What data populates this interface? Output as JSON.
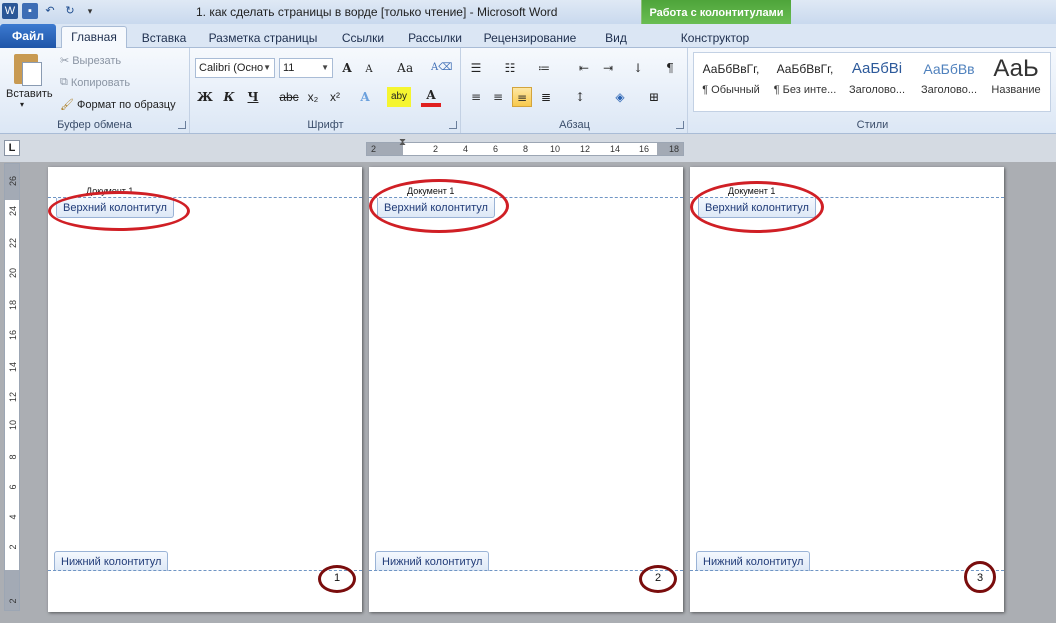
{
  "window": {
    "title": "1. как сделать страницы в ворде [только чтение]  -  Microsoft Word",
    "context_group": "Работа с колонтитулами"
  },
  "tabs": [
    {
      "label": "Файл"
    },
    {
      "label": "Главная"
    },
    {
      "label": "Вставка"
    },
    {
      "label": "Разметка страницы"
    },
    {
      "label": "Ссылки"
    },
    {
      "label": "Рассылки"
    },
    {
      "label": "Рецензирование"
    },
    {
      "label": "Вид"
    },
    {
      "label": "Конструктор"
    }
  ],
  "ribbon": {
    "clipboard": {
      "paste": "Вставить",
      "cut": "Вырезать",
      "copy": "Копировать",
      "format_painter": "Формат по образцу",
      "label": "Буфер обмена"
    },
    "font": {
      "name": "Calibri (Осно",
      "size": "11",
      "label": "Шрифт",
      "grow": "A",
      "shrink": "A",
      "change_case": "Аа",
      "bold": "Ж",
      "italic": "К",
      "underline": "Ч",
      "strike": "abc",
      "subscript": "x₂",
      "superscript": "x²",
      "effects": "A",
      "highlight": "aby",
      "color": "A"
    },
    "paragraph": {
      "label": "Абзац",
      "marks": "¶"
    },
    "styles": {
      "label": "Стили",
      "items": [
        {
          "sample": "АаБбВвГг,",
          "name": "¶ Обычный"
        },
        {
          "sample": "АаБбВвГг,",
          "name": "¶ Без инте..."
        },
        {
          "sample": "АаБбВі",
          "name": "Заголово..."
        },
        {
          "sample": "АаБбВв",
          "name": "Заголово..."
        },
        {
          "sample": "АаЬ",
          "name": "Название"
        }
      ]
    }
  },
  "ruler": {
    "tab_selector": "L",
    "h_numbers": [
      "2",
      "2",
      "4",
      "6",
      "8",
      "10",
      "12",
      "14",
      "16",
      "18"
    ],
    "v_numbers": [
      "26",
      "24",
      "22",
      "20",
      "18",
      "16",
      "14",
      "12",
      "10",
      "8",
      "6",
      "4",
      "2",
      "2"
    ]
  },
  "pages": [
    {
      "doc_title": "Документ 1",
      "header_tag": "Верхний колонтитул",
      "footer_tag": "Нижний колонтитул",
      "page_number": "1"
    },
    {
      "doc_title": "Документ 1",
      "header_tag": "Верхний колонтитул",
      "footer_tag": "Нижний колонтитул",
      "page_number": "2"
    },
    {
      "doc_title": "Документ 1",
      "header_tag": "Верхний колонтитул",
      "footer_tag": "Нижний колонтитул",
      "page_number": "3"
    }
  ],
  "colors": {
    "highlight_ellipse": "#d01f25",
    "page_number_ring": "#7a0d0d",
    "context_tab": "#4ea43a"
  }
}
